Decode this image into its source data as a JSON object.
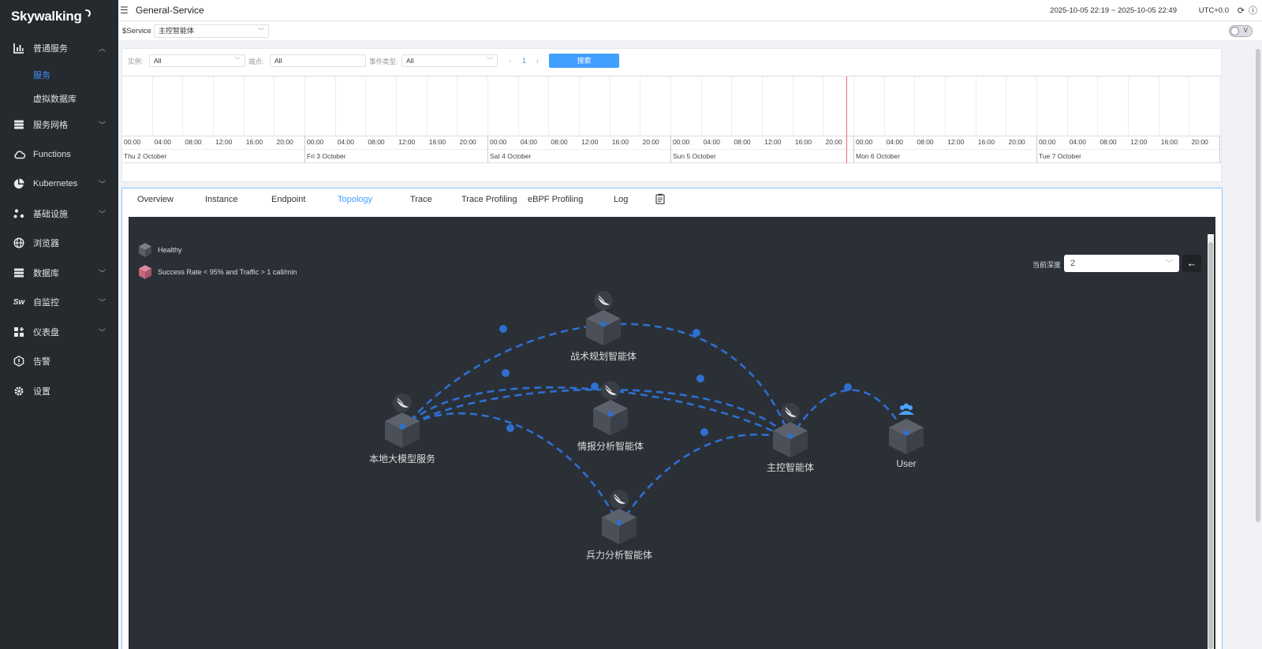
{
  "sidebar": {
    "logo": "Skywalking",
    "items": [
      {
        "label": "普通服务",
        "icon": "chart-bar-icon",
        "chevron": "up"
      },
      {
        "label": "服务网格",
        "icon": "database-stack-icon",
        "chevron": "down"
      },
      {
        "label": "Functions",
        "icon": "cloud-icon",
        "chevron": ""
      },
      {
        "label": "Kubernetes",
        "icon": "pie-chart-icon",
        "chevron": "down"
      },
      {
        "label": "基础设施",
        "icon": "nodes-icon",
        "chevron": "down"
      },
      {
        "label": "浏览器",
        "icon": "globe-icon",
        "chevron": ""
      },
      {
        "label": "数据库",
        "icon": "table-list-icon",
        "chevron": "down"
      },
      {
        "label": "自监控",
        "icon": "sw-icon",
        "chevron": "down"
      },
      {
        "label": "仪表盘",
        "icon": "dashboard-grid-icon",
        "chevron": "down"
      },
      {
        "label": "告警",
        "icon": "alert-icon",
        "chevron": ""
      },
      {
        "label": "设置",
        "icon": "gear-icon",
        "chevron": ""
      }
    ],
    "submenu": [
      {
        "label": "服务",
        "active": true
      },
      {
        "label": "虚拟数据库",
        "active": false
      }
    ]
  },
  "header": {
    "title": "General-Service",
    "time_range": "2025-10-05 22:19 ~ 2025-10-05 22:49",
    "timezone": "UTC+0.0"
  },
  "service_bar": {
    "label": "$Service",
    "selected": "主控智能体",
    "toggle_label": "V"
  },
  "events": {
    "instance_label": "实例:",
    "instance_value": "All",
    "endpoint_label": "端点:",
    "endpoint_value": "All",
    "event_type_label": "事件类型:",
    "event_type_value": "All",
    "page": "1",
    "search_label": "搜索",
    "hours": [
      "00:00",
      "04:00",
      "08:00",
      "12:00",
      "16:00",
      "20:00"
    ],
    "days": [
      "Thu 2 October",
      "Fri 3 October",
      "Sat 4 October",
      "Sun 5 October",
      "Mon 6 October",
      "Tue 7 October"
    ]
  },
  "tabs": [
    "Overview",
    "Instance",
    "Endpoint",
    "Topology",
    "Trace",
    "Trace Profiling",
    "eBPF Profiling",
    "Log"
  ],
  "active_tab": "Topology",
  "topology": {
    "legend": [
      {
        "label": "Healthy",
        "color": "#6b707a"
      },
      {
        "label": "Success Rate < 95% and Traffic > 1 call/min",
        "color": "#c4667c"
      }
    ],
    "depth_label": "当前深度",
    "depth_value": "2",
    "back_label": "←",
    "nodes": [
      {
        "label": "战术规划智能体",
        "icon": "agent-icon"
      },
      {
        "label": "本地大模型服务",
        "icon": "agent-icon"
      },
      {
        "label": "情报分析智能体",
        "icon": "agent-icon"
      },
      {
        "label": "主控智能体",
        "icon": "agent-icon"
      },
      {
        "label": "User",
        "icon": "users-icon"
      },
      {
        "label": "兵力分析智能体",
        "icon": "agent-icon"
      }
    ],
    "colors": {
      "link": "#2f6fd0",
      "background": "#2b3037",
      "node": "#4a4f58"
    }
  }
}
